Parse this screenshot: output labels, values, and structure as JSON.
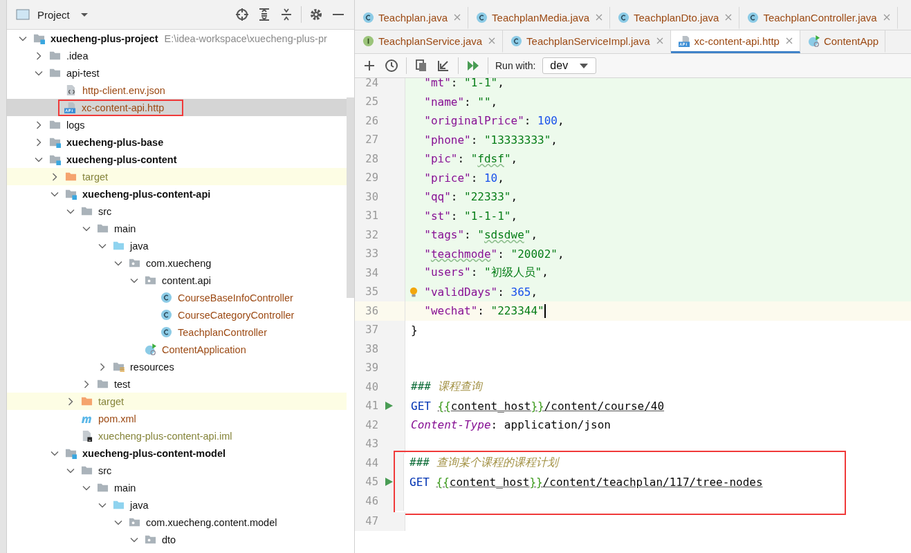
{
  "project_panel": {
    "title": "Project",
    "tree": [
      {
        "label": "xuecheng-plus-project",
        "path": "E:\\idea-workspace\\xuecheng-plus-pr",
        "kind": "module",
        "expanded": true,
        "selected": false,
        "annotated": false,
        "children": [
          {
            "label": ".idea",
            "kind": "folder",
            "expanded": false,
            "selected": false,
            "annotated": false
          },
          {
            "label": "api-test",
            "kind": "folder",
            "expanded": true,
            "selected": false,
            "annotated": false,
            "children": [
              {
                "label": "http-client.env.json",
                "kind": "json",
                "color": "#9c4a14",
                "selected": false,
                "annotated": false
              },
              {
                "label": "xc-content-api.http",
                "kind": "http",
                "color": "#9c4a14",
                "selected": true,
                "annotated": true
              }
            ]
          },
          {
            "label": "logs",
            "kind": "folder",
            "expanded": false,
            "selected": false,
            "annotated": false
          },
          {
            "label": "xuecheng-plus-base",
            "kind": "module",
            "expanded": false,
            "selected": false,
            "annotated": false
          },
          {
            "label": "xuecheng-plus-content",
            "kind": "module",
            "expanded": true,
            "selected": false,
            "annotated": false,
            "children": [
              {
                "label": "target",
                "kind": "folder-excluded",
                "color": "#85843a",
                "expanded": false,
                "selected": false,
                "annotated": false
              },
              {
                "label": "xuecheng-plus-content-api",
                "kind": "module",
                "expanded": true,
                "selected": false,
                "annotated": false,
                "children": [
                  {
                    "label": "src",
                    "kind": "folder",
                    "expanded": true,
                    "selected": false,
                    "annotated": false,
                    "children": [
                      {
                        "label": "main",
                        "kind": "folder",
                        "expanded": true,
                        "selected": false,
                        "annotated": false,
                        "children": [
                          {
                            "label": "java",
                            "kind": "folder-source",
                            "expanded": true,
                            "selected": false,
                            "annotated": false,
                            "children": [
                              {
                                "label": "com.xuecheng",
                                "kind": "package",
                                "expanded": true,
                                "selected": false,
                                "annotated": false,
                                "children": [
                                  {
                                    "label": "content.api",
                                    "kind": "package",
                                    "expanded": true,
                                    "selected": false,
                                    "annotated": false,
                                    "children": [
                                      {
                                        "label": "CourseBaseInfoController",
                                        "kind": "class",
                                        "color": "#9c4a14",
                                        "selected": false,
                                        "annotated": false
                                      },
                                      {
                                        "label": "CourseCategoryController",
                                        "kind": "class",
                                        "color": "#9c4a14",
                                        "selected": false,
                                        "annotated": false
                                      },
                                      {
                                        "label": "TeachplanController",
                                        "kind": "class",
                                        "color": "#9c4a14",
                                        "selected": false,
                                        "annotated": false
                                      }
                                    ]
                                  },
                                  {
                                    "label": "ContentApplication",
                                    "kind": "app",
                                    "color": "#9c4a14",
                                    "selected": false,
                                    "annotated": false
                                  }
                                ]
                              }
                            ]
                          },
                          {
                            "label": "resources",
                            "kind": "folder-resources",
                            "expanded": false,
                            "selected": false,
                            "annotated": false
                          }
                        ]
                      },
                      {
                        "label": "test",
                        "kind": "folder",
                        "expanded": false,
                        "selected": false,
                        "annotated": false
                      }
                    ]
                  },
                  {
                    "label": "target",
                    "kind": "folder-excluded",
                    "color": "#85843a",
                    "expanded": false,
                    "selected": false,
                    "annotated": false
                  },
                  {
                    "label": "pom.xml",
                    "kind": "maven",
                    "color": "#9c4a14",
                    "selected": false,
                    "annotated": false
                  },
                  {
                    "label": "xuecheng-plus-content-api.iml",
                    "kind": "iml",
                    "color": "#85843a",
                    "selected": false,
                    "annotated": false
                  }
                ]
              },
              {
                "label": "xuecheng-plus-content-model",
                "kind": "module",
                "expanded": true,
                "selected": false,
                "annotated": false,
                "children": [
                  {
                    "label": "src",
                    "kind": "folder",
                    "expanded": true,
                    "selected": false,
                    "annotated": false,
                    "children": [
                      {
                        "label": "main",
                        "kind": "folder",
                        "expanded": true,
                        "selected": false,
                        "annotated": false,
                        "children": [
                          {
                            "label": "java",
                            "kind": "folder-source",
                            "expanded": true,
                            "selected": false,
                            "annotated": false,
                            "children": [
                              {
                                "label": "com.xuecheng.content.model",
                                "kind": "package",
                                "expanded": true,
                                "selected": false,
                                "annotated": false,
                                "children": [
                                  {
                                    "label": "dto",
                                    "kind": "package",
                                    "expanded": true,
                                    "selected": false,
                                    "annotated": false
                                  }
                                ]
                              }
                            ]
                          }
                        ]
                      }
                    ]
                  }
                ]
              }
            ]
          }
        ]
      }
    ]
  },
  "editor_tabs": [
    [
      {
        "label": "Teachplan.java",
        "kind": "class",
        "selected": false,
        "closable": true
      },
      {
        "label": "TeachplanMedia.java",
        "kind": "class",
        "selected": false,
        "closable": true
      },
      {
        "label": "TeachplanDto.java",
        "kind": "class",
        "selected": false,
        "closable": true
      },
      {
        "label": "TeachplanController.java",
        "kind": "class",
        "selected": false,
        "closable": true
      }
    ],
    [
      {
        "label": "TeachplanService.java",
        "kind": "interface",
        "selected": false,
        "closable": true
      },
      {
        "label": "TeachplanServiceImpl.java",
        "kind": "class",
        "selected": false,
        "closable": true
      },
      {
        "label": "xc-content-api.http",
        "kind": "http",
        "selected": true,
        "closable": true
      },
      {
        "label": "ContentApp",
        "kind": "app",
        "selected": false,
        "closable": false
      }
    ]
  ],
  "toolbar": {
    "run_with_label": "Run with:",
    "environment": "dev"
  },
  "editor": {
    "lines": [
      {
        "number": "24",
        "modified": true,
        "current": false,
        "runnable": false,
        "intention": false,
        "annotated": false,
        "tokens": [
          {
            "kind": "key",
            "text": "  \"mt\""
          },
          {
            "kind": "punct",
            "text": ": "
          },
          {
            "kind": "string",
            "text": "\"1-1\""
          },
          {
            "kind": "punct",
            "text": ","
          }
        ]
      },
      {
        "number": "25",
        "modified": true,
        "current": false,
        "runnable": false,
        "intention": false,
        "annotated": false,
        "tokens": [
          {
            "kind": "key",
            "text": "  \"name\""
          },
          {
            "kind": "punct",
            "text": ": "
          },
          {
            "kind": "string",
            "text": "\"\""
          },
          {
            "kind": "punct",
            "text": ","
          }
        ]
      },
      {
        "number": "26",
        "modified": true,
        "current": false,
        "runnable": false,
        "intention": false,
        "annotated": false,
        "tokens": [
          {
            "kind": "key",
            "text": "  \"originalPrice\""
          },
          {
            "kind": "punct",
            "text": ": "
          },
          {
            "kind": "number",
            "text": "100"
          },
          {
            "kind": "punct",
            "text": ","
          }
        ]
      },
      {
        "number": "27",
        "modified": true,
        "current": false,
        "runnable": false,
        "intention": false,
        "annotated": false,
        "tokens": [
          {
            "kind": "key",
            "text": "  \"phone\""
          },
          {
            "kind": "punct",
            "text": ": "
          },
          {
            "kind": "string",
            "text": "\"13333333\""
          },
          {
            "kind": "punct",
            "text": ","
          }
        ]
      },
      {
        "number": "28",
        "modified": true,
        "current": false,
        "runnable": false,
        "intention": false,
        "annotated": false,
        "tokens": [
          {
            "kind": "key",
            "text": "  \"pic\""
          },
          {
            "kind": "punct",
            "text": ": "
          },
          {
            "kind": "string",
            "text": "\""
          },
          {
            "kind": "string-typo",
            "text": "fdsf"
          },
          {
            "kind": "string",
            "text": "\""
          },
          {
            "kind": "punct",
            "text": ","
          }
        ]
      },
      {
        "number": "29",
        "modified": true,
        "current": false,
        "runnable": false,
        "intention": false,
        "annotated": false,
        "tokens": [
          {
            "kind": "key",
            "text": "  \"price\""
          },
          {
            "kind": "punct",
            "text": ": "
          },
          {
            "kind": "number",
            "text": "10"
          },
          {
            "kind": "punct",
            "text": ","
          }
        ]
      },
      {
        "number": "30",
        "modified": true,
        "current": false,
        "runnable": false,
        "intention": false,
        "annotated": false,
        "tokens": [
          {
            "kind": "key",
            "text": "  \"qq\""
          },
          {
            "kind": "punct",
            "text": ": "
          },
          {
            "kind": "string",
            "text": "\"22333\""
          },
          {
            "kind": "punct",
            "text": ","
          }
        ]
      },
      {
        "number": "31",
        "modified": true,
        "current": false,
        "runnable": false,
        "intention": false,
        "annotated": false,
        "tokens": [
          {
            "kind": "key",
            "text": "  \"st\""
          },
          {
            "kind": "punct",
            "text": ": "
          },
          {
            "kind": "string",
            "text": "\"1-1-1\""
          },
          {
            "kind": "punct",
            "text": ","
          }
        ]
      },
      {
        "number": "32",
        "modified": true,
        "current": false,
        "runnable": false,
        "intention": false,
        "annotated": false,
        "tokens": [
          {
            "kind": "key",
            "text": "  \"tags\""
          },
          {
            "kind": "punct",
            "text": ": "
          },
          {
            "kind": "string",
            "text": "\""
          },
          {
            "kind": "string-typo",
            "text": "sdsdwe"
          },
          {
            "kind": "string",
            "text": "\""
          },
          {
            "kind": "punct",
            "text": ","
          }
        ]
      },
      {
        "number": "33",
        "modified": true,
        "current": false,
        "runnable": false,
        "intention": false,
        "annotated": false,
        "tokens": [
          {
            "kind": "key",
            "text": "  \""
          },
          {
            "kind": "key-typo",
            "text": "teachmode"
          },
          {
            "kind": "key",
            "text": "\""
          },
          {
            "kind": "punct",
            "text": ": "
          },
          {
            "kind": "string",
            "text": "\"20002\""
          },
          {
            "kind": "punct",
            "text": ","
          }
        ]
      },
      {
        "number": "34",
        "modified": true,
        "current": false,
        "runnable": false,
        "intention": false,
        "annotated": false,
        "tokens": [
          {
            "kind": "key",
            "text": "  \"users\""
          },
          {
            "kind": "punct",
            "text": ": "
          },
          {
            "kind": "string",
            "text": "\"初级人员\""
          },
          {
            "kind": "punct",
            "text": ","
          }
        ]
      },
      {
        "number": "35",
        "modified": true,
        "current": false,
        "runnable": false,
        "intention": true,
        "annotated": false,
        "tokens": [
          {
            "kind": "key",
            "text": "  \"validDays\""
          },
          {
            "kind": "punct",
            "text": ": "
          },
          {
            "kind": "number",
            "text": "365"
          },
          {
            "kind": "punct",
            "text": ","
          }
        ]
      },
      {
        "number": "36",
        "modified": false,
        "current": true,
        "runnable": false,
        "intention": false,
        "annotated": false,
        "tokens": [
          {
            "kind": "key",
            "text": "  \"wechat\""
          },
          {
            "kind": "punct",
            "text": ": "
          },
          {
            "kind": "string",
            "text": "\"223344\""
          }
        ]
      },
      {
        "number": "37",
        "modified": false,
        "current": false,
        "runnable": false,
        "intention": false,
        "annotated": false,
        "tokens": [
          {
            "kind": "punct",
            "text": "}"
          }
        ]
      },
      {
        "number": "38",
        "modified": false,
        "current": false,
        "runnable": false,
        "intention": false,
        "annotated": false
      },
      {
        "number": "39",
        "modified": false,
        "current": false,
        "runnable": false,
        "intention": false,
        "annotated": false
      },
      {
        "number": "40",
        "modified": false,
        "current": false,
        "runnable": false,
        "intention": false,
        "annotated": false,
        "tokens": [
          {
            "kind": "comment-mark",
            "text": "###"
          },
          {
            "kind": "comment",
            "text": " 课程查询"
          }
        ]
      },
      {
        "number": "41",
        "modified": false,
        "current": false,
        "runnable": true,
        "intention": false,
        "annotated": false,
        "tokens": [
          {
            "kind": "method",
            "text": "GET "
          },
          {
            "kind": "var-brace",
            "text": "{{"
          },
          {
            "kind": "var",
            "text": "content_host"
          },
          {
            "kind": "var-brace",
            "text": "}}"
          },
          {
            "kind": "url",
            "text": "/content/course/40"
          }
        ]
      },
      {
        "number": "42",
        "modified": false,
        "current": false,
        "runnable": false,
        "intention": false,
        "annotated": false,
        "tokens": [
          {
            "kind": "header",
            "text": "Content-Type"
          },
          {
            "kind": "punct",
            "text": ": application/json"
          }
        ]
      },
      {
        "number": "43",
        "modified": false,
        "current": false,
        "runnable": false,
        "intention": false,
        "annotated": false
      },
      {
        "number": "44",
        "modified": false,
        "current": false,
        "runnable": false,
        "intention": false,
        "annotated": true,
        "tokens": [
          {
            "kind": "comment-mark",
            "text": "###"
          },
          {
            "kind": "comment",
            "text": " 查询某个课程的课程计划"
          }
        ]
      },
      {
        "number": "45",
        "modified": false,
        "current": false,
        "runnable": true,
        "intention": false,
        "annotated": true,
        "tokens": [
          {
            "kind": "method",
            "text": "GET "
          },
          {
            "kind": "var-brace",
            "text": "{{"
          },
          {
            "kind": "var",
            "text": "content_host"
          },
          {
            "kind": "var-brace",
            "text": "}}"
          },
          {
            "kind": "url",
            "text": "/content/teachplan/117/tree-nodes"
          }
        ]
      },
      {
        "number": "46",
        "modified": false,
        "current": false,
        "runnable": false,
        "intention": false,
        "annotated": true
      },
      {
        "number": "47",
        "modified": false,
        "current": false,
        "runnable": false,
        "intention": false,
        "annotated": false
      }
    ]
  }
}
